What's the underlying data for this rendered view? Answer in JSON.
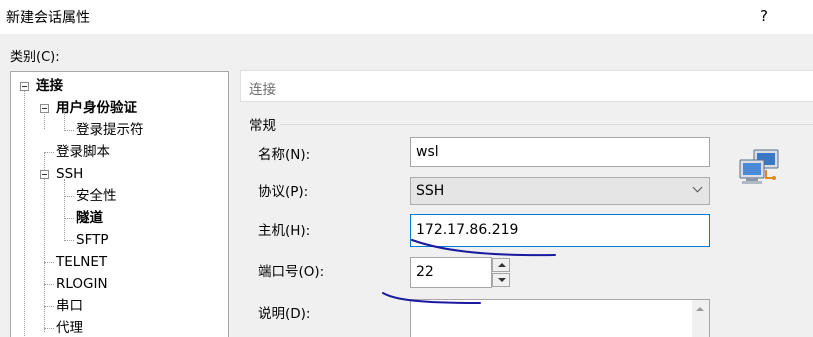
{
  "window": {
    "title": "新建会话属性",
    "help_label": "?"
  },
  "category_label": "类别(C):",
  "tree": {
    "items": [
      {
        "label": "连接"
      },
      {
        "label": "用户身份验证"
      },
      {
        "label": "登录提示符"
      },
      {
        "label": "登录脚本"
      },
      {
        "label": "SSH"
      },
      {
        "label": "安全性"
      },
      {
        "label": "隧道"
      },
      {
        "label": "SFTP"
      },
      {
        "label": "TELNET"
      },
      {
        "label": "RLOGIN"
      },
      {
        "label": "串口"
      },
      {
        "label": "代理"
      }
    ]
  },
  "section": {
    "header": "连接",
    "group": "常规"
  },
  "form": {
    "name": {
      "label": "名称(N):",
      "value": "wsl"
    },
    "protocol": {
      "label": "协议(P):",
      "value": "SSH"
    },
    "host": {
      "label": "主机(H):",
      "value": "172.17.86.219"
    },
    "port": {
      "label": "端口号(O):",
      "value": "22"
    },
    "description": {
      "label": "说明(D):",
      "value": ""
    }
  },
  "icons": {
    "network": "network-computers-icon",
    "collapse": "collapse-icon",
    "dropdown": "chevron-down-icon"
  },
  "colors": {
    "annotation": "#1a1aa0",
    "focus": "#0078d7"
  }
}
